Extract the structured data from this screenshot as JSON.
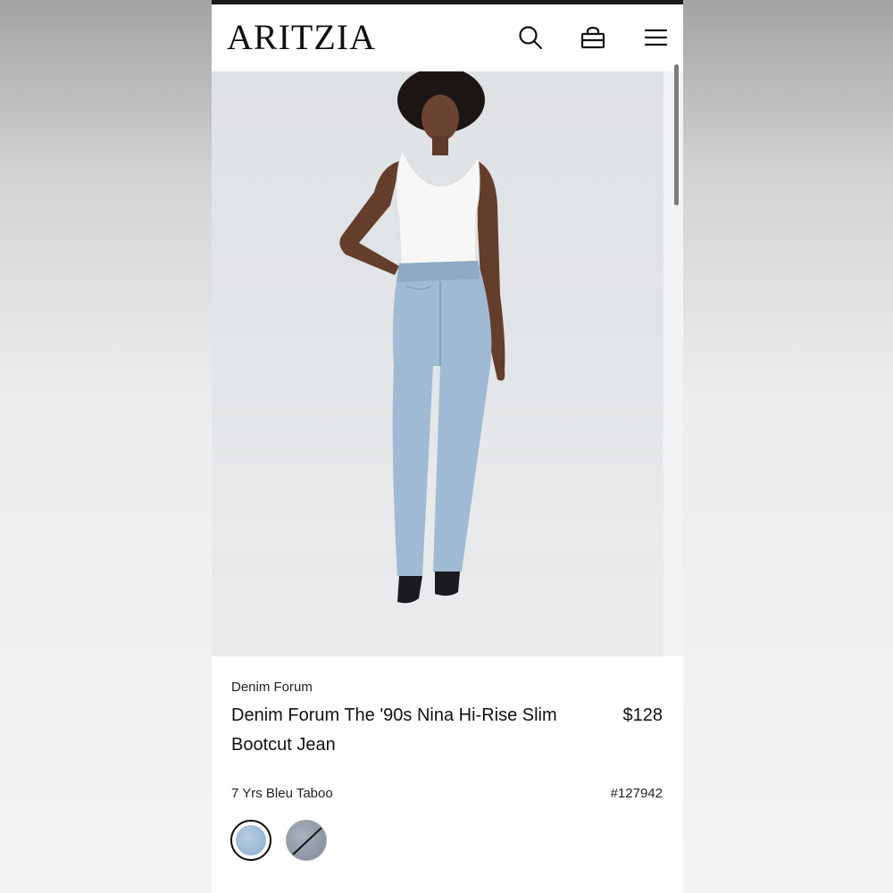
{
  "header": {
    "logo": "ARITZIA",
    "icons": [
      "search-icon",
      "shopping-bag-icon",
      "hamburger-menu-icon"
    ]
  },
  "product": {
    "brand": "Denim Forum",
    "name": "Denim Forum The '90s Nina Hi-Rise Slim Bootcut Jean",
    "price": "$128",
    "color": "7 Yrs Bleu Taboo",
    "sku": "#127942",
    "swatches": [
      {
        "name": "light-blue-swatch",
        "selected": true,
        "available": true
      },
      {
        "name": "grey-blue-swatch",
        "selected": false,
        "available": false
      }
    ]
  },
  "colors": {
    "background": "#ffffff",
    "text": "#111111",
    "scrollbar": "#7c7c7c"
  }
}
